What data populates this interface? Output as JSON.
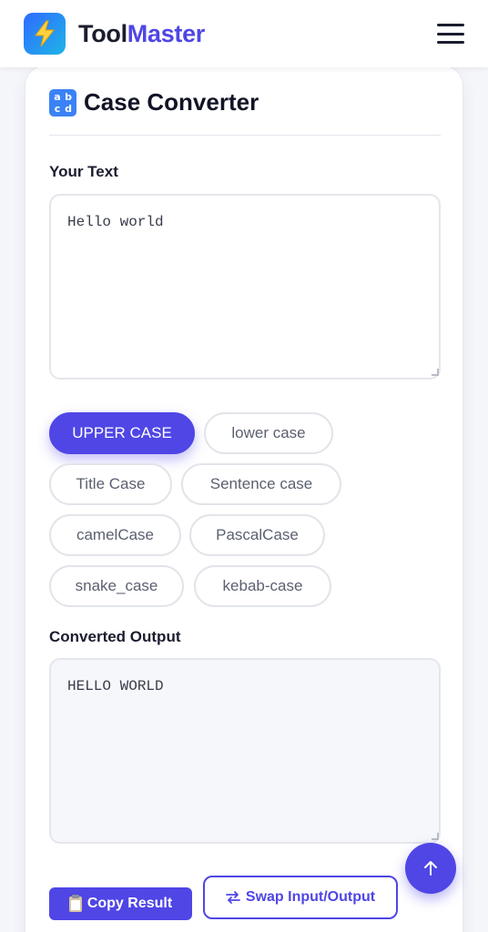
{
  "header": {
    "brand_part1": "Tool",
    "brand_part2": "Master",
    "logo_icon": "lightning-bolt-icon",
    "menu_icon": "hamburger-menu-icon"
  },
  "tool": {
    "title": "Case Converter",
    "title_icon": "abcd-input-icon",
    "input_label": "Your Text",
    "input_value": "Hello world",
    "output_label": "Converted Output",
    "output_value": "HELLO WORLD"
  },
  "case_options": [
    {
      "label": "UPPER CASE",
      "active": true
    },
    {
      "label": "lower case",
      "active": false
    },
    {
      "label": "Title Case",
      "active": false
    },
    {
      "label": "Sentence case",
      "active": false
    },
    {
      "label": "camelCase",
      "active": false
    },
    {
      "label": "PascalCase",
      "active": false
    },
    {
      "label": "snake_case",
      "active": false
    },
    {
      "label": "kebab-case",
      "active": false
    }
  ],
  "actions": {
    "copy_label": "Copy Result",
    "copy_icon": "clipboard-icon",
    "swap_label": "Swap Input/Output",
    "swap_icon": "swap-arrows-icon",
    "scroll_top_icon": "arrow-up-icon"
  },
  "colors": {
    "accent": "#4f46e5",
    "brand_dark": "#1a1d2e",
    "chip_border": "#e2e4ea",
    "logo_gradient_start": "#2f6bff",
    "logo_gradient_end": "#1fb4e8"
  }
}
